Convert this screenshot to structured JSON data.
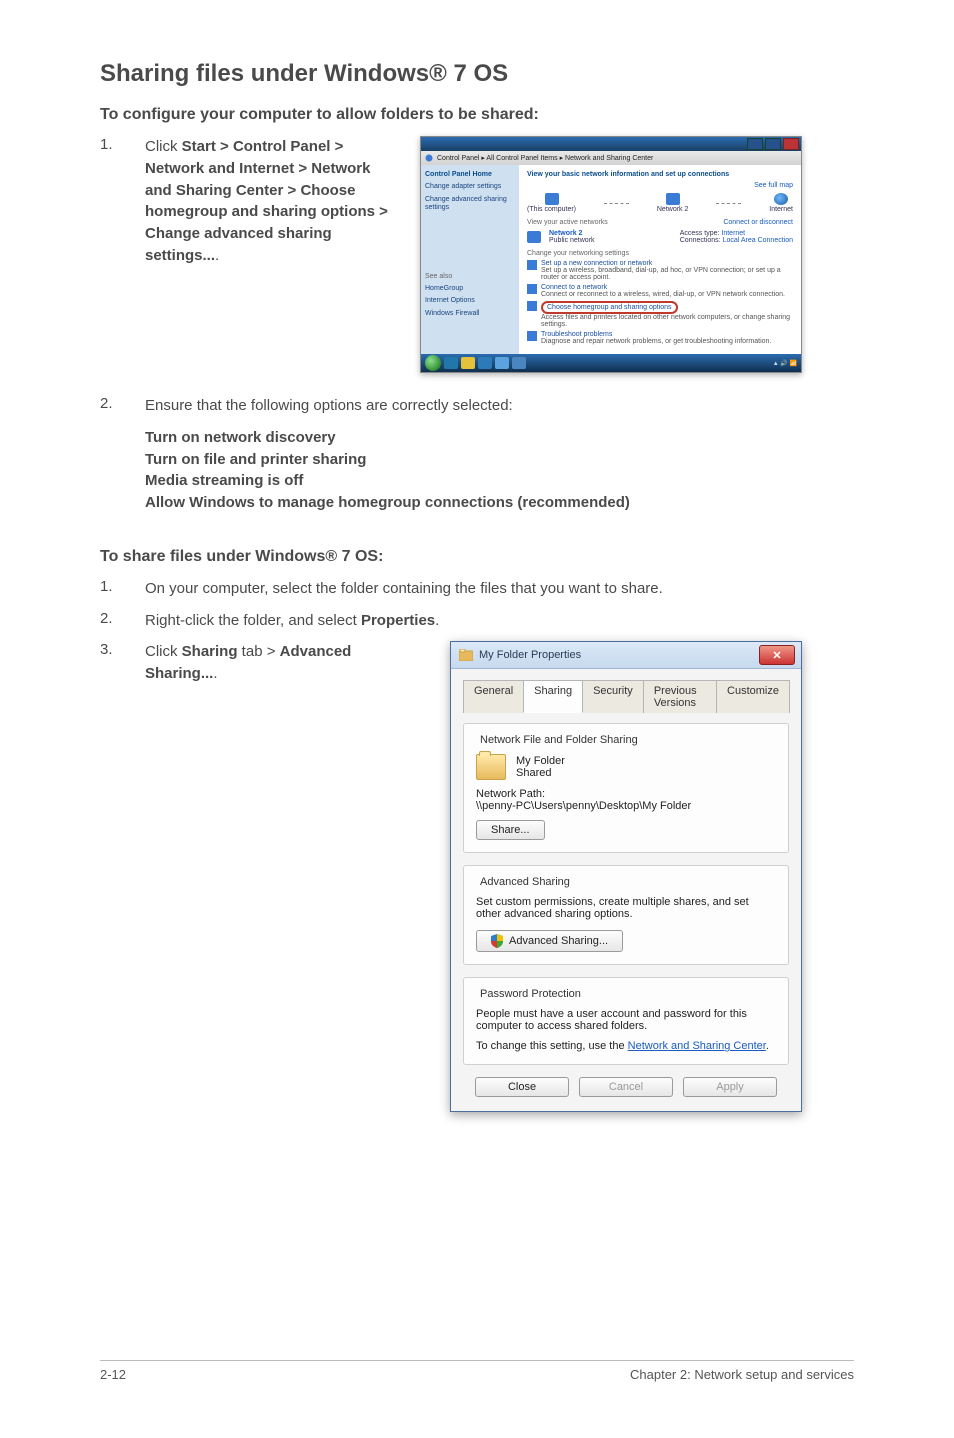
{
  "heading": "Sharing files under Windows® 7 OS",
  "configure_sub": "To configure your computer to allow folders to be shared:",
  "step1_num": "1.",
  "step1_prefix": "Click ",
  "step1_path": "Start > Control Panel > Network and Internet > Network and Sharing Center > Choose homegroup and sharing options > Change advanced sharing settings...",
  "step1_suffix": ".",
  "step2_num": "2.",
  "step2_text": "Ensure that the following options are correctly selected:",
  "step2_opts": [
    "Turn on network discovery",
    "Turn on file and printer sharing",
    "Media streaming is off",
    "Allow Windows to manage homegroup connections (recommended)"
  ],
  "share_sub": "To share files under Windows® 7 OS:",
  "share1_num": "1.",
  "share1_text": "On your computer, select the folder containing the files that you want to share.",
  "share2_num": "2.",
  "share2_a": "Right-click the folder, and select ",
  "share2_b": "Properties",
  "share2_c": ".",
  "share3_num": "3.",
  "share3_a": "Click ",
  "share3_b": "Sharing",
  "share3_c": " tab > ",
  "share3_d": "Advanced Sharing...",
  "share3_e": ".",
  "nsc": {
    "breadcrumb": "Control Panel ▸ All Control Panel Items ▸ Network and Sharing Center",
    "side": {
      "home": "Control Panel Home",
      "adapter": "Change adapter settings",
      "advanced": "Change advanced sharing settings",
      "seealso": "See also",
      "hg": "HomeGroup",
      "io": "Internet Options",
      "wf": "Windows Firewall"
    },
    "main_heading": "View your basic network information and set up connections",
    "fullmap": "See full map",
    "node_pc": "(This computer)",
    "node_net": "Network 2",
    "node_inet": "Internet",
    "active_label": "View your active networks",
    "conn_disc": "Connect or disconnect",
    "net_name": "Network 2",
    "net_type": "Public network",
    "access_lbl": "Access type:",
    "access_val": "Internet",
    "conn_lbl": "Connections:",
    "conn_val": "Local Area Connection",
    "change_heading": "Change your networking settings",
    "link_setup_t": "Set up a new connection or network",
    "link_setup_d": "Set up a wireless, broadband, dial-up, ad hoc, or VPN connection; or set up a router or access point.",
    "link_connect_t": "Connect to a network",
    "link_connect_d": "Connect or reconnect to a wireless, wired, dial-up, or VPN network connection.",
    "link_hg_t": "Choose homegroup and sharing options",
    "link_hg_d": "Access files and printers located on other network computers, or change sharing settings.",
    "link_ts_t": "Troubleshoot problems",
    "link_ts_d": "Diagnose and repair network problems, or get troubleshooting information."
  },
  "dlg": {
    "title": "My Folder Properties",
    "tabs": {
      "general": "General",
      "sharing": "Sharing",
      "security": "Security",
      "prev": "Previous Versions",
      "custom": "Customize"
    },
    "g1_title": "Network File and Folder Sharing",
    "folder_name": "My Folder",
    "folder_state": "Shared",
    "netpath_lbl": "Network Path:",
    "netpath_val": "\\\\penny-PC\\Users\\penny\\Desktop\\My Folder",
    "share_btn": "Share...",
    "g2_title": "Advanced Sharing",
    "g2_desc": "Set custom permissions, create multiple shares, and set other advanced sharing options.",
    "adv_btn": "Advanced Sharing...",
    "g3_title": "Password Protection",
    "g3_line1": "People must have a user account and password for this computer to access shared folders.",
    "g3_line2a": "To change this setting, use the ",
    "g3_link": "Network and Sharing Center",
    "g3_line2b": ".",
    "btn_close": "Close",
    "btn_cancel": "Cancel",
    "btn_apply": "Apply"
  },
  "footer_left": "2-12",
  "footer_right": "Chapter 2:  Network setup and services"
}
